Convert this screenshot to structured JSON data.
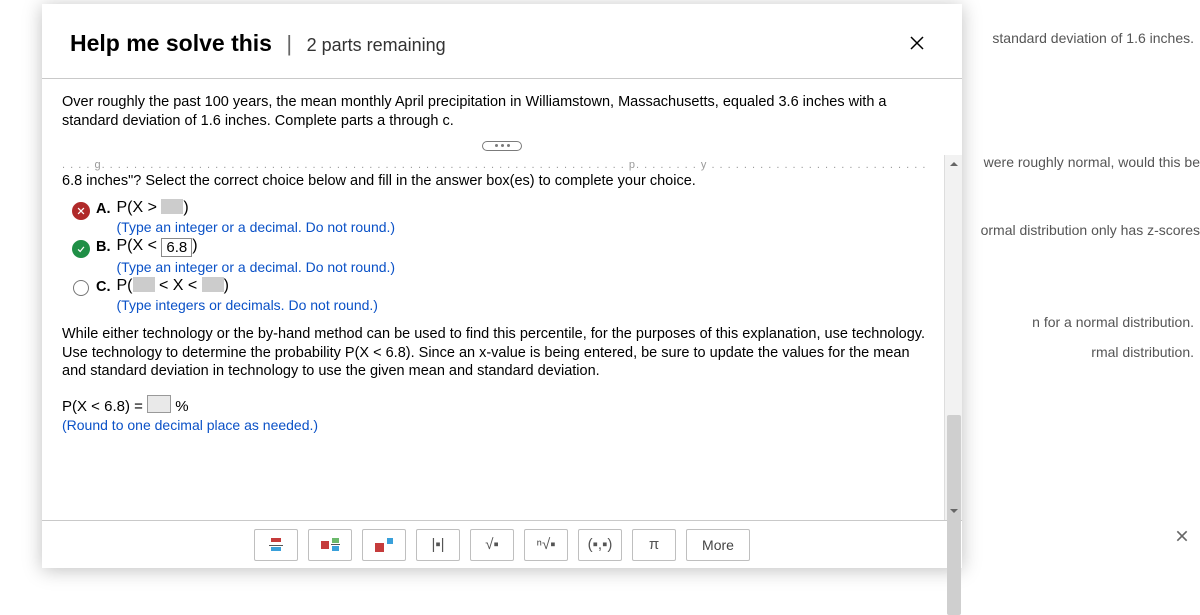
{
  "backdrop": {
    "l1": "standard deviation of 1.6 inches.",
    "l2": "were roughly normal, would this be",
    "l3": "ormal distribution only has z-scores",
    "l4": "n for a normal distribution.",
    "l5": "rmal distribution."
  },
  "modal": {
    "title": "Help me solve this",
    "sep": "|",
    "subtitle": "2 parts remaining",
    "problem": "Over roughly the past 100 years, the mean monthly April precipitation in Williamstown, Massachusetts, equaled 3.6 inches with a standard deviation of 1.6 inches. Complete parts a through c.",
    "truncated_row": ". . . . g. . . . . . . . . . . . . . . . . . . . . . . . . . . . . . . . . . . . . . . . . . . . . . . . . . . . . . . . . . . . . . . . . p. . . . . . . . y . . . . . . . . . . . . . . . . . . . . . . . . . . . . p. . . . . . . . . . . . . . . . . . .",
    "prompt": "6.8 inches\"? Select the correct choice below and fill in the answer box(es) to complete your choice.",
    "choices": {
      "a": {
        "letter": "A.",
        "prefix": "P(X > ",
        "suffix": ")",
        "hint": "(Type an integer or a decimal. Do not round.)"
      },
      "b": {
        "letter": "B.",
        "prefix": "P(X < ",
        "value": "6.8",
        "suffix": ")",
        "hint": "(Type an integer or a decimal. Do not round.)"
      },
      "c": {
        "letter": "C.",
        "prefix": "P(",
        "middle": " < X < ",
        "suffix": ")",
        "hint": "(Type integers or decimals. Do not round.)"
      }
    },
    "explain": "While either technology or the by-hand method can be used to find this percentile, for the purposes of this explanation, use technology. Use technology to determine the probability P(X < 6.8). Since an x-value is being entered, be sure to update the values for the mean and standard deviation in technology to use the given mean and standard deviation.",
    "eq_left": "P(X < 6.8) = ",
    "eq_right": "%",
    "eq_hint": "(Round to one decimal place as needed.)"
  },
  "toolbar": {
    "abs": "|▪|",
    "sqrt": "√▪",
    "nthroot": "ⁿ√▪",
    "interval": "(▪,▪)",
    "pi": "π",
    "more": "More"
  }
}
